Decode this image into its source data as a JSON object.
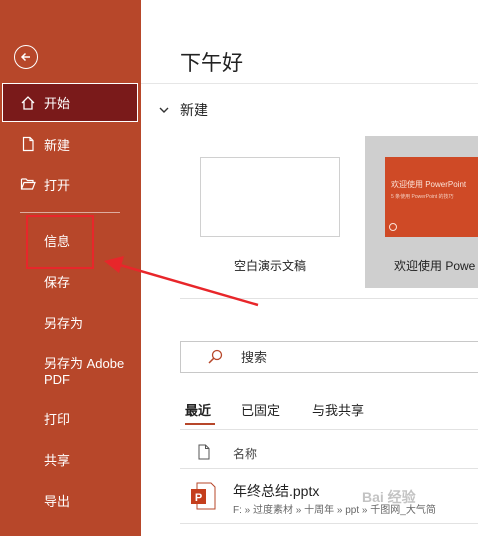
{
  "sidebar": {
    "back_icon": "back-arrow-icon",
    "items": [
      {
        "label": "开始",
        "icon": "home-icon",
        "active": true
      },
      {
        "label": "新建",
        "icon": "new-file-icon"
      },
      {
        "label": "打开",
        "icon": "folder-open-icon"
      }
    ],
    "sub_items": [
      "信息",
      "保存",
      "另存为",
      "另存为 Adobe",
      "PDF",
      "打印",
      "共享",
      "导出"
    ],
    "colors": {
      "background": "#b7472a",
      "active": "#7a1a1a",
      "highlight_box": "#e8262a"
    }
  },
  "main": {
    "greeting": "下午好",
    "new_section": {
      "title": "新建"
    },
    "templates": [
      {
        "label": "空白演示文稿"
      },
      {
        "label": "欢迎使用 Powe",
        "thumb_title": "欢迎使用 PowerPoint",
        "thumb_subtitle": "5 条使用 PowerPoint 的技巧"
      }
    ],
    "search": {
      "placeholder": "搜索"
    },
    "tabs": [
      "最近",
      "已固定",
      "与我共享"
    ],
    "file_list": {
      "column_name": "名称",
      "files": [
        {
          "name": "年终总结.pptx",
          "path": "F: » 过度素材 » 十周年 » ppt » 千图网_大气简"
        }
      ]
    }
  },
  "watermark": "Bai 经验"
}
